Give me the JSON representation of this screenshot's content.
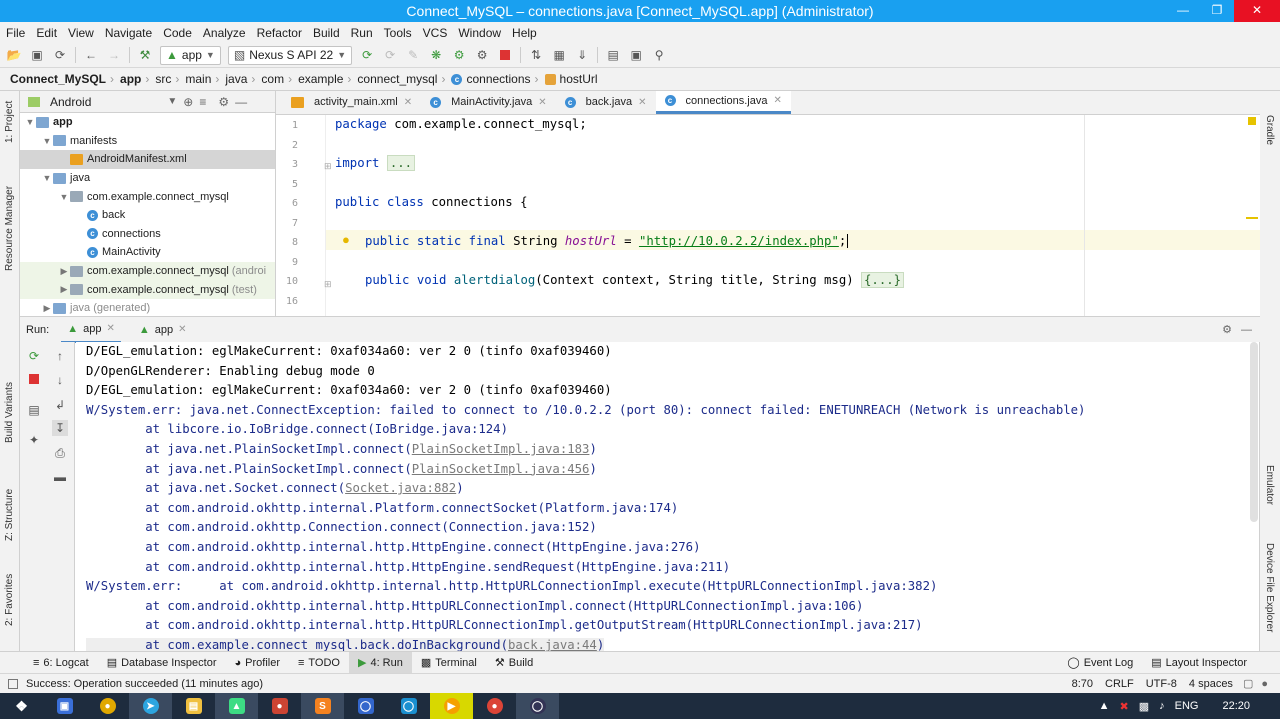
{
  "window": {
    "title": "Connect_MySQL – connections.java [Connect_MySQL.app] (Administrator)"
  },
  "menu": [
    "File",
    "Edit",
    "View",
    "Navigate",
    "Code",
    "Analyze",
    "Refactor",
    "Build",
    "Run",
    "Tools",
    "VCS",
    "Window",
    "Help"
  ],
  "toolbar": {
    "config": "app",
    "device": "Nexus S API 22"
  },
  "breadcrumb": [
    "Connect_MySQL",
    "app",
    "src",
    "main",
    "java",
    "com",
    "example",
    "connect_mysql",
    "connections",
    "hostUrl"
  ],
  "project": {
    "view": "Android",
    "tree": [
      {
        "label": "app",
        "kind": "folder",
        "level": 0,
        "open": true
      },
      {
        "label": "manifests",
        "kind": "folder",
        "level": 1,
        "open": true
      },
      {
        "label": "AndroidManifest.xml",
        "kind": "xml",
        "level": 2,
        "selected": true
      },
      {
        "label": "java",
        "kind": "folder",
        "level": 1,
        "open": true
      },
      {
        "label": "com.example.connect_mysql",
        "kind": "folderg",
        "level": 2,
        "open": true
      },
      {
        "label": "back",
        "kind": "class",
        "level": 3
      },
      {
        "label": "connections",
        "kind": "class",
        "level": 3
      },
      {
        "label": "MainActivity",
        "kind": "class",
        "level": 3
      },
      {
        "label": "com.example.connect_mysql",
        "suffix": "(androi",
        "kind": "folderg",
        "level": 2,
        "collapsed": true,
        "hl": true
      },
      {
        "label": "com.example.connect_mysql",
        "suffix": "(test)",
        "kind": "folderg",
        "level": 2,
        "collapsed": true,
        "hl": true
      },
      {
        "label": "java (generated)",
        "kind": "folder",
        "level": 1,
        "collapsed": true
      }
    ]
  },
  "editor": {
    "tabs": [
      {
        "label": "activity_main.xml",
        "kind": "xml"
      },
      {
        "label": "MainActivity.java",
        "kind": "class"
      },
      {
        "label": "back.java",
        "kind": "class"
      },
      {
        "label": "connections.java",
        "kind": "class",
        "active": true
      }
    ],
    "line_numbers": [
      "1",
      "2",
      "3",
      "5",
      "6",
      "7",
      "8",
      "9",
      "10",
      "16"
    ],
    "code": {
      "l1_kw": "package",
      "l1_rest": " com.example.connect_mysql;",
      "l3_kw": "import",
      "l3_fold": "...",
      "l6_kw": "public class",
      "l6_rest": " connections {",
      "l8_kw": "public static final",
      "l8_type": " String ",
      "l8_field": "hostUrl",
      "l8_eq": " = ",
      "l8_str": "\"http://10.0.2.2/index.php\"",
      "l8_end": ";",
      "l10_kw": "public void",
      "l10_sp": " ",
      "l10_method": "alertdialog",
      "l10_args": "(Context context, String title, String msg) ",
      "l10_fold": "{...}"
    }
  },
  "run": {
    "label": "Run:",
    "tabs": [
      "app",
      "app"
    ],
    "lines": [
      {
        "t": "D/EGL_emulation: eglMakeCurrent: 0xaf034a60: ver 2 0 (tinfo 0xaf039460)",
        "err": false
      },
      {
        "t": "D/OpenGLRenderer: Enabling debug mode 0",
        "err": false
      },
      {
        "t": "D/EGL_emulation: eglMakeCurrent: 0xaf034a60: ver 2 0 (tinfo 0xaf039460)",
        "err": false
      },
      {
        "t": "W/System.err: java.net.ConnectException: failed to connect to /10.0.2.2 (port 80): connect failed: ENETUNREACH (Network is unreachable)",
        "err": true
      },
      {
        "t": "        at libcore.io.IoBridge.connect(IoBridge.java:124)",
        "err": true
      },
      {
        "t": "        at java.net.PlainSocketImpl.connect(",
        "link": "PlainSocketImpl.java:183",
        "t2": ")",
        "err": true
      },
      {
        "t": "        at java.net.PlainSocketImpl.connect(",
        "link": "PlainSocketImpl.java:456",
        "t2": ")",
        "err": true
      },
      {
        "t": "        at java.net.Socket.connect(",
        "link": "Socket.java:882",
        "t2": ")",
        "err": true
      },
      {
        "t": "        at com.android.okhttp.internal.Platform.connectSocket(Platform.java:174)",
        "err": true
      },
      {
        "t": "        at com.android.okhttp.Connection.connect(Connection.java:152)",
        "err": true
      },
      {
        "t": "        at com.android.okhttp.internal.http.HttpEngine.connect(HttpEngine.java:276)",
        "err": true
      },
      {
        "t": "        at com.android.okhttp.internal.http.HttpEngine.sendRequest(HttpEngine.java:211)",
        "err": true
      },
      {
        "t": "W/System.err:     at com.android.okhttp.internal.http.HttpURLConnectionImpl.execute(HttpURLConnectionImpl.java:382)",
        "err": true
      },
      {
        "t": "        at com.android.okhttp.internal.http.HttpURLConnectionImpl.connect(HttpURLConnectionImpl.java:106)",
        "err": true
      },
      {
        "t": "        at com.android.okhttp.internal.http.HttpURLConnectionImpl.getOutputStream(HttpURLConnectionImpl.java:217)",
        "err": true
      },
      {
        "t": "        at com.example.connect_mysql.back.doInBackground(",
        "link": "back.java:44",
        "t2": ")",
        "err": true
      }
    ]
  },
  "side": {
    "left": [
      "1: Project",
      "Resource Manager",
      "Build Variants",
      "Z: Structure",
      "2: Favorites"
    ],
    "right": [
      "Gradle",
      "Emulator",
      "Device File Explorer"
    ]
  },
  "bottom_tabs": [
    "6: Logcat",
    "Database Inspector",
    "Profiler",
    "TODO",
    "4: Run",
    "Terminal",
    "Build"
  ],
  "bottom_right": [
    "Event Log",
    "Layout Inspector"
  ],
  "status": {
    "message": "Success: Operation succeeded (11 minutes ago)",
    "position": "8:70",
    "line_sep": "CRLF",
    "encoding": "UTF-8",
    "indent": "4 spaces"
  },
  "taskbar": {
    "lang": "ENG",
    "time": "22:20"
  },
  "colors": {
    "titlebar": "#19a0f0",
    "accent": "#4a88c7",
    "keyword": "#0033b3",
    "string": "#067d17",
    "error_text": "#1c2b8a",
    "taskbar": "#1e2c3e"
  }
}
